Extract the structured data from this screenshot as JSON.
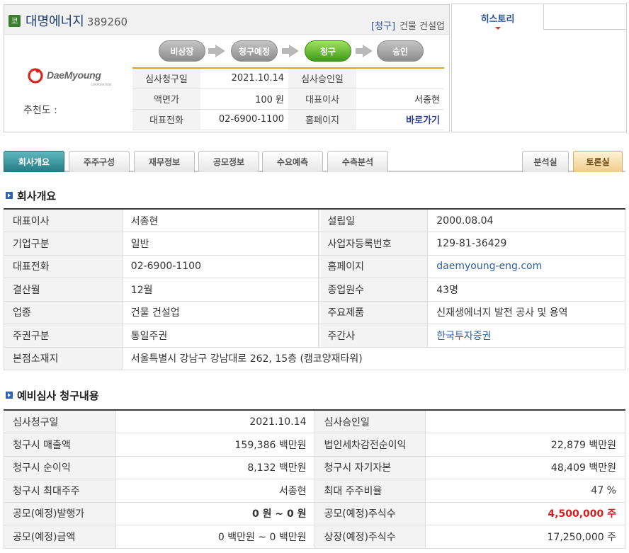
{
  "header": {
    "market_badge": "코",
    "company_name": "대명에너지",
    "company_code": "389260",
    "status": "[청구]",
    "industry": "건물 건설업",
    "logo_text": "DaeMyoung",
    "logo_sub": "CORPORATION",
    "recommend_label": "추천도 :",
    "steps": [
      {
        "label": "비상장",
        "active": false
      },
      {
        "label": "청구예정",
        "active": false
      },
      {
        "label": "청구",
        "active": true
      },
      {
        "label": "승인",
        "active": false
      }
    ],
    "info": [
      {
        "k1": "심사청구일",
        "v1": "2021.10.14",
        "k2": "심사승인일",
        "v2": ""
      },
      {
        "k1": "액면가",
        "v1": "100  원",
        "k2": "대표이사",
        "v2": "서종현"
      },
      {
        "k1": "대표전화",
        "v1": "02-6900-1100",
        "k2": "홈페이지",
        "v2": "바로가기"
      }
    ]
  },
  "history": {
    "tab_label": "히스토리"
  },
  "tabs": {
    "left": [
      "회사개요",
      "주주구성",
      "재무정보",
      "공모정보",
      "수요예측",
      "수측분석"
    ],
    "right": [
      "분석실",
      "토론실"
    ]
  },
  "overview": {
    "title": "회사개요",
    "rows": [
      [
        "대표이사",
        "서종현",
        "설립일",
        "2000.08.04"
      ],
      [
        "기업구분",
        "일반",
        "사업자등록번호",
        "129-81-36429"
      ],
      [
        "대표전화",
        "02-6900-1100",
        "홈페이지",
        "daemyoung-eng.com"
      ],
      [
        "결산월",
        "12월",
        "종업원수",
        "43명"
      ],
      [
        "업종",
        "건물 건설업",
        "주요제품",
        "신재생에너지 발전 공사 및 용역"
      ],
      [
        "주권구분",
        "통일주권",
        "주간사",
        "한국투자증권"
      ]
    ],
    "address_label": "본점소재지",
    "address": "서울특별시 강남구 강남대로 262, 15층 (캠코양재타워)"
  },
  "prelim": {
    "title": "예비심사 청구내용",
    "rows": [
      [
        "심사청구일",
        "2021.10.14",
        "심사승인일",
        ""
      ],
      [
        "청구시 매출액",
        "159,386 백만원",
        "법인세차감전순이익",
        "22,879 백만원"
      ],
      [
        "청구시 순이익",
        "8,132 백만원",
        "청구시 자기자본",
        "48,409 백만원"
      ],
      [
        "청구시 최대주주",
        "서종현",
        "최대 주주비율",
        "47 %"
      ],
      [
        "공모(예정)발행가",
        "0 원 ~ 0 원",
        "공모(예정)주식수",
        "4,500,000 주"
      ],
      [
        "공모(예정)금액",
        "0 백만원 ~ 0 백만원",
        "상장(예정)주식수",
        "17,250,000 주"
      ]
    ]
  }
}
